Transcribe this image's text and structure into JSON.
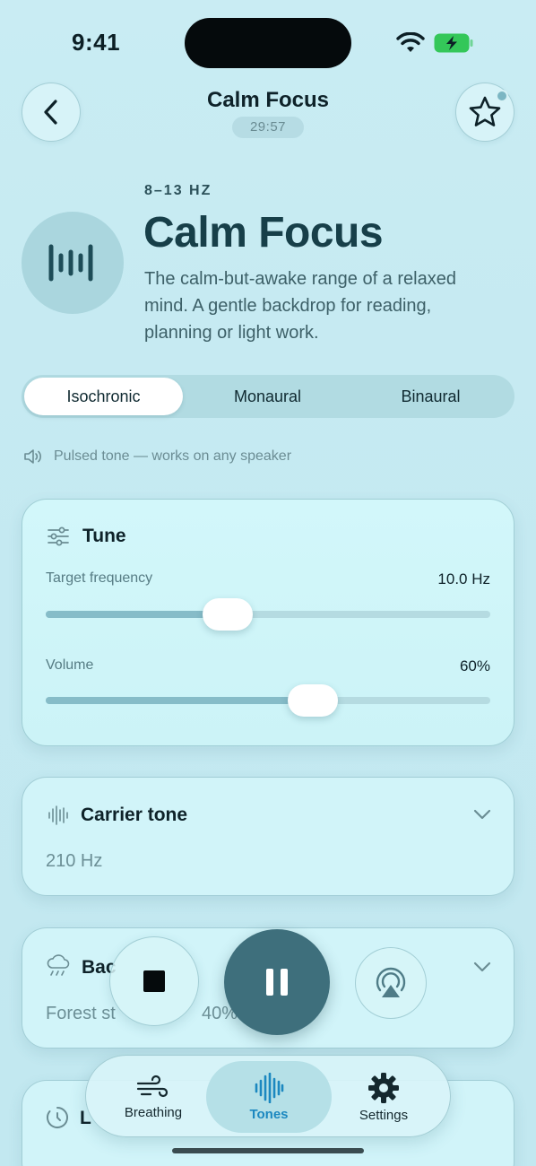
{
  "status": {
    "time": "9:41"
  },
  "header": {
    "title": "Calm Focus",
    "timer": "29:57"
  },
  "hero": {
    "range": "8–13 HZ",
    "title": "Calm Focus",
    "description": "The calm-but-awake range of a relaxed mind. A gentle backdrop for reading, planning or light work."
  },
  "modes": {
    "options": [
      "Isochronic",
      "Monaural",
      "Binaural"
    ],
    "selected": "Isochronic"
  },
  "hint": "Pulsed tone — works on any speaker",
  "tune": {
    "title": "Tune",
    "frequency": {
      "label": "Target frequency",
      "value": "10.0 Hz",
      "fraction": 0.41
    },
    "volume": {
      "label": "Volume",
      "value": "60%",
      "fraction": 0.6
    }
  },
  "carrier": {
    "title": "Carrier tone",
    "value": "210 Hz"
  },
  "background": {
    "title": "Bac",
    "value": "Forest st",
    "percent": "40%"
  },
  "timer_card": {
    "title": "L"
  },
  "tabs": [
    {
      "label": "Breathing",
      "icon": "wind-icon"
    },
    {
      "label": "Tones",
      "icon": "waveform-icon"
    },
    {
      "label": "Settings",
      "icon": "gear-icon"
    }
  ],
  "colors": {
    "accent": "#3e6f7c",
    "active_tab": "#1c88c0",
    "background": "#c6eaf2"
  }
}
